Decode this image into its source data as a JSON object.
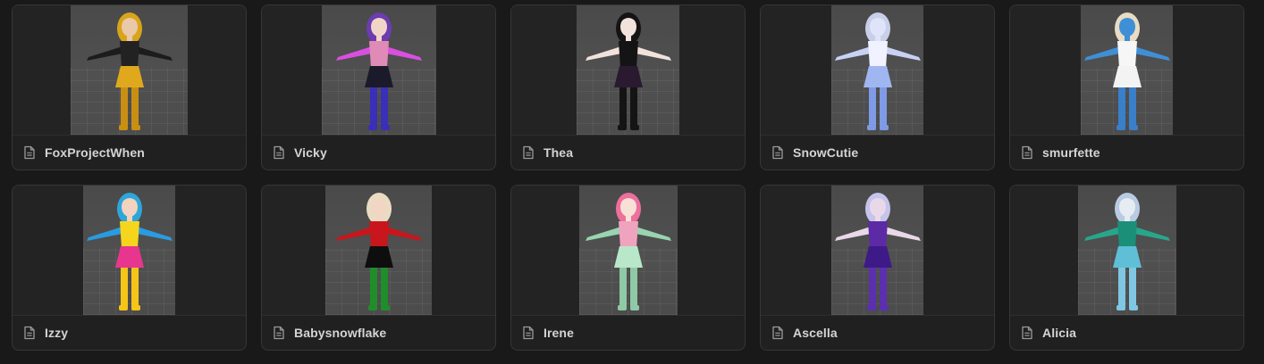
{
  "gallery": {
    "cards": [
      {
        "title": "FoxProjectWhen",
        "palette": {
          "hair": "#d8a51a",
          "top": "#222222",
          "bottom": "#e0a91d",
          "skin": "#e9c9a9",
          "legs": "#c98f12",
          "arms": "#1c1c1c"
        }
      },
      {
        "title": "Vicky",
        "palette": {
          "hair": "#6c3cb0",
          "top": "#e08ab8",
          "bottom": "#1a1a2a",
          "skin": "#f1d6c8",
          "legs": "#3a2fb8",
          "arms": "#d94fe0"
        }
      },
      {
        "title": "Thea",
        "palette": {
          "hair": "#141414",
          "top": "#141414",
          "bottom": "#2a1a30",
          "skin": "#f2e2dc",
          "legs": "#141414",
          "arms": "#f2e2dc"
        }
      },
      {
        "title": "SnowCutie",
        "palette": {
          "hair": "#c8cfe8",
          "top": "#f0f2ff",
          "bottom": "#9fb6f0",
          "skin": "#dfe4fb",
          "legs": "#7f9ae6",
          "arms": "#c7d2f5"
        }
      },
      {
        "title": "smurfette",
        "palette": {
          "hair": "#e8dcc4",
          "top": "#f6f6f6",
          "bottom": "#f3f3f3",
          "skin": "#3f8fd6",
          "legs": "#3a7fc9",
          "arms": "#3f8fd6"
        }
      },
      {
        "title": "Izzy",
        "palette": {
          "hair": "#2fa6d9",
          "top": "#f6d51d",
          "bottom": "#e8368f",
          "skin": "#f1d3bf",
          "legs": "#f5c517",
          "arms": "#2a9be0"
        }
      },
      {
        "title": "Babysnowflake",
        "palette": {
          "hair": "#e9dcc2",
          "top": "#c8161c",
          "bottom": "#0e0e0e",
          "skin": "#f1d6c3",
          "legs": "#1f8e2a",
          "arms": "#c8161c"
        }
      },
      {
        "title": "Irene",
        "palette": {
          "hair": "#ee6f9c",
          "top": "#f0a3bf",
          "bottom": "#b9e7c9",
          "skin": "#f7e0d6",
          "legs": "#8fc9a6",
          "arms": "#98d4b0"
        }
      },
      {
        "title": "Ascella",
        "palette": {
          "hair": "#c4c4ec",
          "top": "#5d2aa6",
          "bottom": "#3d1a88",
          "skin": "#e9d9e8",
          "legs": "#5b2fb0",
          "arms": "#e9d9e8"
        }
      },
      {
        "title": "Alicia",
        "palette": {
          "hair": "#b9cbe2",
          "top": "#1b8f78",
          "bottom": "#5fbfd6",
          "skin": "#e6ecf2",
          "legs": "#7fc7e3",
          "arms": "#27a68c"
        }
      }
    ],
    "doc_icon_name": "document-icon"
  }
}
